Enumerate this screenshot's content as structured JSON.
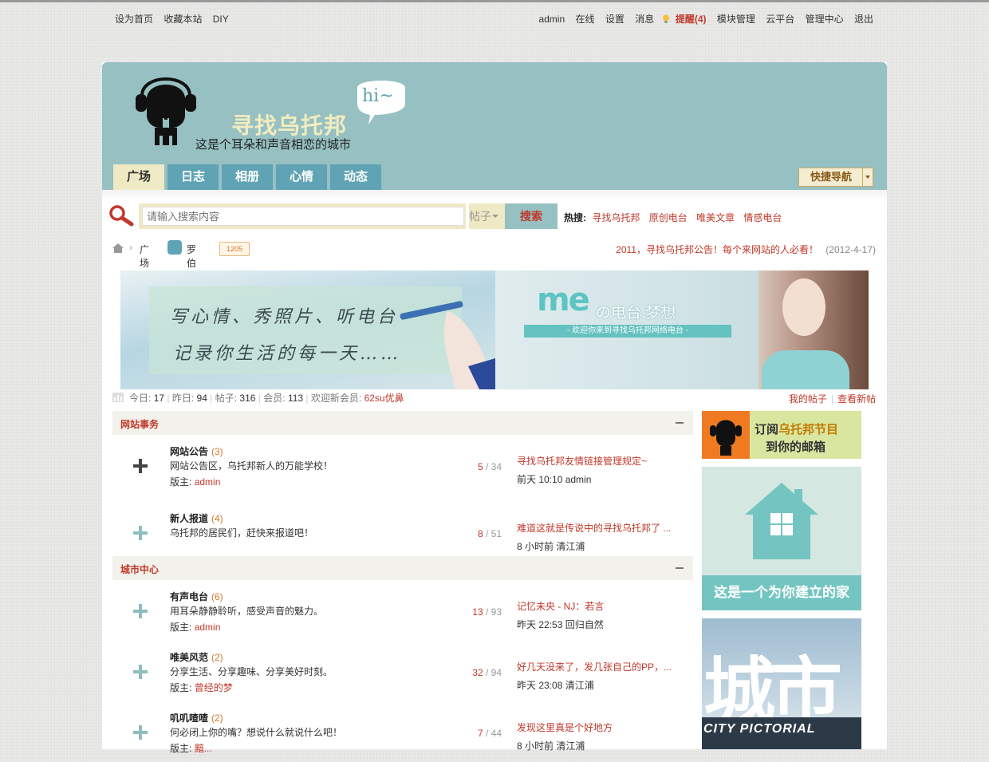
{
  "topbar": {
    "left_links": [
      "设为首页",
      "收藏本站",
      "DIY"
    ],
    "right_links": [
      "admin",
      "在线",
      "设置",
      "消息"
    ],
    "alert": "提醒(4)",
    "right_links_after": [
      "模块管理",
      "云平台",
      "管理中心",
      "退出"
    ]
  },
  "header": {
    "title": "寻找乌托邦",
    "slogan": "这是个耳朵和声音相恋的城市",
    "bubble": "hi~",
    "tabs": [
      "广场",
      "日志",
      "相册",
      "心情",
      "动态"
    ],
    "active_tab": "广场",
    "quicknav": "快捷导航"
  },
  "search": {
    "placeholder": "请输入搜索内容",
    "scope": "帖子",
    "button": "搜索",
    "hot_label": "热搜:",
    "hot": [
      "寻找乌托邦",
      "原创电台",
      "唯美文章",
      "情感电台"
    ]
  },
  "breadcrumb": {
    "c1": "广场",
    "c2": "罗伯生",
    "badge": "1205"
  },
  "notice": {
    "title": "2011，寻找乌托邦公告！每个来网站的人必看！",
    "date": "(2012-4-17)"
  },
  "banner": {
    "left_line1": "写心情、秀照片、听电台",
    "left_line2": "记录你生活的每一天……",
    "me": "me",
    "radio": "の电台.梦想",
    "strip": "- 欢迎你来到寻找乌托邦网络电台 -"
  },
  "stats": {
    "today_label": "今日:",
    "today": "17",
    "yesterday_label": "昨日:",
    "yesterday": "94",
    "posts_label": "帖子:",
    "posts": "316",
    "members_label": "会员:",
    "members": "113",
    "newmember_label": "欢迎新会员:",
    "newmember": "62su优鼻"
  },
  "mine": [
    "我的帖子",
    "查看新帖"
  ],
  "groups": [
    {
      "name": "网站事务",
      "forums": [
        {
          "name": "网站公告",
          "count": "(3)",
          "desc": "网站公告区，乌托邦新人的万能学校！",
          "mod_label": "版主:",
          "mod": "admin",
          "threads": "5",
          "posts": "34",
          "last_title": "寻找乌托邦友情链接管理规定~",
          "last_meta": "前天 10:10 admin"
        },
        {
          "name": "新人报道",
          "count": "(4)",
          "desc": "乌托邦的居民们，赶快来报道吧！",
          "mod_label": "",
          "mod": "",
          "threads": "8",
          "posts": "51",
          "last_title": "难道这就是传说中的寻找乌托邦了 ...",
          "last_meta": "8 小时前 清江浦"
        }
      ]
    },
    {
      "name": "城市中心",
      "forums": [
        {
          "name": "有声电台",
          "count": "(6)",
          "desc": "用耳朵静静聆听，感受声音的魅力。",
          "mod_label": "版主:",
          "mod": "admin",
          "threads": "13",
          "posts": "93",
          "last_title": "记忆未央 - NJ：若言",
          "last_meta": "昨天 22:53 回归自然"
        },
        {
          "name": "唯美风范",
          "count": "(2)",
          "desc": "分享生活、分享趣味、分享美好时刻。",
          "mod_label": "版主:",
          "mod": "曾经的梦",
          "threads": "32",
          "posts": "94",
          "last_title": "好几天没来了，发几张自己的PP，...",
          "last_meta": "昨天 23:08 清江浦"
        },
        {
          "name": "叽叽喳喳",
          "count": "(2)",
          "desc": "何必闭上你的嘴？想说什么就说什么吧！",
          "mod_label": "版主:",
          "mod": "黯...",
          "threads": "7",
          "posts": "44",
          "last_title": "发现这里真是个好地方",
          "last_meta": "8 小时前 清江浦"
        }
      ]
    }
  ],
  "side": {
    "ad1_line1_a": "订阅",
    "ad1_line1_b": "乌托邦节目",
    "ad1_line2": "到你的邮箱",
    "ad2_caption": "这是一个为你建立的家",
    "ad3_big": "城市",
    "ad3_band": "CITY PICTORIAL"
  },
  "colors": {
    "header_bg": "#96c0c1",
    "nav_tab": "#5fa3b4",
    "nav_active": "#efe9c4",
    "accent_red": "#c0392b"
  }
}
